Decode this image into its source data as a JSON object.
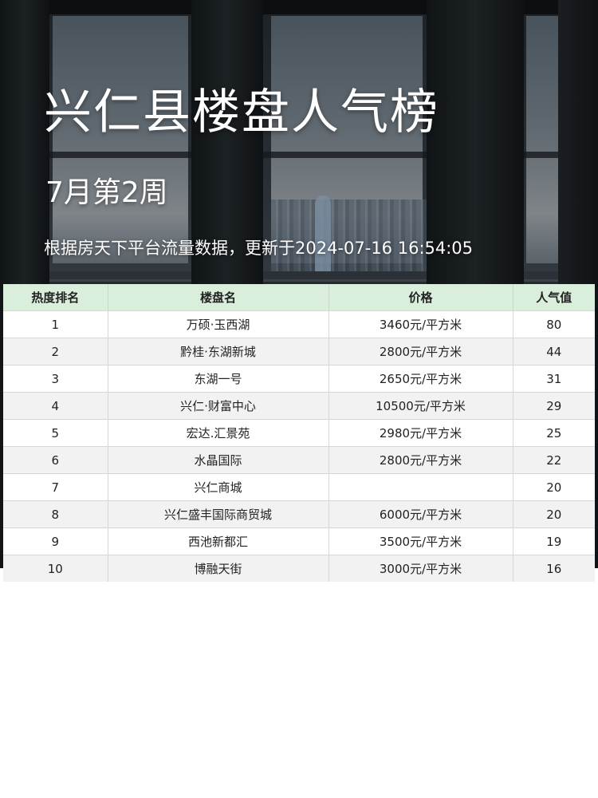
{
  "header": {
    "title": "兴仁县楼盘人气榜",
    "period": "7月第2周",
    "updated": "根据房天下平台流量数据，更新于2024-07-16 16:54:05"
  },
  "table": {
    "columns": [
      "热度排名",
      "楼盘名",
      "价格",
      "人气值"
    ],
    "rows": [
      {
        "rank": "1",
        "name": "万硕·玉西湖",
        "price": "3460元/平方米",
        "popularity": "80"
      },
      {
        "rank": "2",
        "name": "黔桂·东湖新城",
        "price": "2800元/平方米",
        "popularity": "44"
      },
      {
        "rank": "3",
        "name": "东湖一号",
        "price": "2650元/平方米",
        "popularity": "31"
      },
      {
        "rank": "4",
        "name": "兴仁·财富中心",
        "price": "10500元/平方米",
        "popularity": "29"
      },
      {
        "rank": "5",
        "name": "宏达.汇景苑",
        "price": "2980元/平方米",
        "popularity": "25"
      },
      {
        "rank": "6",
        "name": "水晶国际",
        "price": "2800元/平方米",
        "popularity": "22"
      },
      {
        "rank": "7",
        "name": "兴仁商城",
        "price": "",
        "popularity": "20"
      },
      {
        "rank": "8",
        "name": "兴仁盛丰国际商贸城",
        "price": "6000元/平方米",
        "popularity": "20"
      },
      {
        "rank": "9",
        "name": "西池新都汇",
        "price": "3500元/平方米",
        "popularity": "19"
      },
      {
        "rank": "10",
        "name": "博融天街",
        "price": "3000元/平方米",
        "popularity": "16"
      }
    ]
  },
  "colors": {
    "header_row": "#d9efdc",
    "row_alt": "#f2f2f2",
    "title_text": "#ffffff"
  }
}
